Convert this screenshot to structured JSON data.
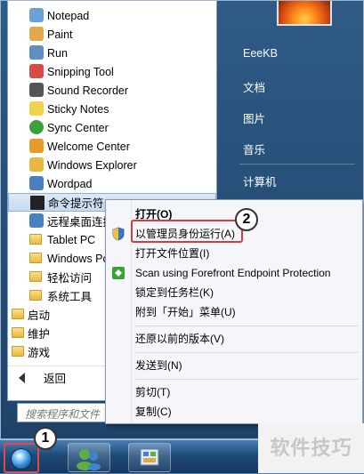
{
  "programs": [
    {
      "label": "Notepad",
      "icon": "notepad-icon",
      "color": "#6aa0d8"
    },
    {
      "label": "Paint",
      "icon": "paint-icon",
      "color": "#e2a84a"
    },
    {
      "label": "Run",
      "icon": "run-icon",
      "color": "#5d8fc2"
    },
    {
      "label": "Snipping Tool",
      "icon": "scissors-icon",
      "color": "#d84a4a"
    },
    {
      "label": "Sound Recorder",
      "icon": "microphone-icon",
      "color": "#555555"
    },
    {
      "label": "Sticky Notes",
      "icon": "sticky-notes-icon",
      "color": "#f2d14f"
    },
    {
      "label": "Sync Center",
      "icon": "sync-icon",
      "color": "#3aa13a"
    },
    {
      "label": "Welcome Center",
      "icon": "welcome-icon",
      "color": "#e89a2a"
    },
    {
      "label": "Windows Explorer",
      "icon": "folder-icon",
      "color": "#e8b93d"
    },
    {
      "label": "Wordpad",
      "icon": "wordpad-icon",
      "color": "#4a7fc2"
    },
    {
      "label": "命令提示符",
      "icon": "cmd-icon",
      "color": "#222222"
    },
    {
      "label": "远程桌面连接",
      "icon": "remote-desktop-icon",
      "color": "#4a80c0"
    },
    {
      "label": "Tablet PC",
      "icon": "folder-icon"
    },
    {
      "label": "Windows Po",
      "icon": "folder-icon"
    },
    {
      "label": "轻松访问",
      "icon": "folder-icon"
    },
    {
      "label": "系统工具",
      "icon": "folder-icon"
    },
    {
      "label": "启动",
      "icon": "folder-icon"
    },
    {
      "label": "维护",
      "icon": "folder-icon"
    },
    {
      "label": "游戏",
      "icon": "folder-icon"
    }
  ],
  "back_label": "返回",
  "search_placeholder": "搜索程序和文件",
  "right_items": [
    "EeeKB",
    "文档",
    "图片",
    "音乐",
    "计算机"
  ],
  "context_menu": {
    "items": [
      {
        "label": "打开(O)",
        "bold": true
      },
      {
        "label": "以管理员身份运行(A)",
        "icon": "shield-icon"
      },
      {
        "label": "打开文件位置(I)"
      },
      {
        "label": "Scan using Forefront Endpoint Protection",
        "icon": "forefront-icon"
      },
      {
        "label": "锁定到任务栏(K)"
      },
      {
        "label": "附到「开始」菜单(U)"
      },
      {
        "label": "还原以前的版本(V)"
      },
      {
        "label": "发送到(N)"
      },
      {
        "label": "剪切(T)"
      },
      {
        "label": "复制(C)"
      }
    ]
  },
  "badges": [
    "1",
    "2"
  ],
  "watermark": "软件技巧",
  "colors": {
    "highlight": "#d93a3a",
    "selected": "#c6dbf2"
  }
}
